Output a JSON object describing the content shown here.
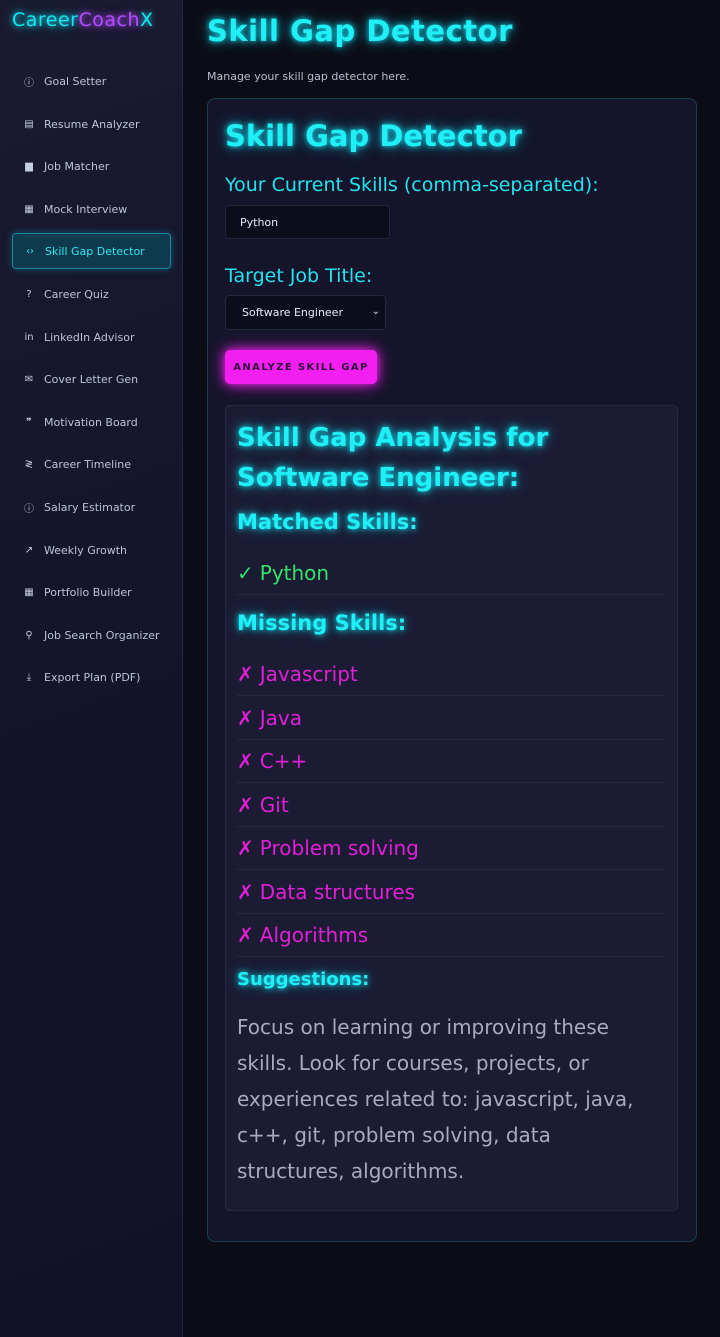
{
  "sidebar": {
    "logo": {
      "part1": "Career",
      "part2": "Coach",
      "part3": "X"
    },
    "items": [
      {
        "label": "Goal Setter",
        "icon": "info-circle-icon",
        "glyph": "ⓘ"
      },
      {
        "label": "Resume Analyzer",
        "icon": "document-icon",
        "glyph": "▤"
      },
      {
        "label": "Job Matcher",
        "icon": "briefcase-icon",
        "glyph": "▆"
      },
      {
        "label": "Mock Interview",
        "icon": "calendar-icon",
        "glyph": "▦"
      },
      {
        "label": "Skill Gap Detector",
        "icon": "code-icon",
        "glyph": "‹›",
        "active": true
      },
      {
        "label": "Career Quiz",
        "icon": "question-circle-icon",
        "glyph": "?"
      },
      {
        "label": "LinkedIn Advisor",
        "icon": "linkedin-icon",
        "glyph": "in"
      },
      {
        "label": "Cover Letter Gen",
        "icon": "envelope-icon",
        "glyph": "✉"
      },
      {
        "label": "Motivation Board",
        "icon": "quote-icon",
        "glyph": "❞"
      },
      {
        "label": "Career Timeline",
        "icon": "timeline-icon",
        "glyph": "≷"
      },
      {
        "label": "Salary Estimator",
        "icon": "info-circle-icon",
        "glyph": "ⓘ"
      },
      {
        "label": "Weekly Growth",
        "icon": "trending-up-icon",
        "glyph": "↗"
      },
      {
        "label": "Portfolio Builder",
        "icon": "calculator-icon",
        "glyph": "▦"
      },
      {
        "label": "Job Search Organizer",
        "icon": "search-icon",
        "glyph": "⚲"
      },
      {
        "label": "Export Plan (PDF)",
        "icon": "download-icon",
        "glyph": "⤓"
      }
    ]
  },
  "main": {
    "title": "Skill Gap Detector",
    "subtitle": "Manage your skill gap detector here."
  },
  "form": {
    "heading": "Skill Gap Detector",
    "skills_label": "Your Current Skills (comma-separated):",
    "skills_value": "Python",
    "job_label": "Target Job Title:",
    "job_value": "Software Engineer",
    "analyze_button": "ANALYZE SKILL GAP"
  },
  "results": {
    "title": "Skill Gap Analysis for Software Engineer:",
    "matched_heading": "Matched Skills:",
    "matched": [
      "Python"
    ],
    "matched_mark": "✓",
    "missing_heading": "Missing Skills:",
    "missing": [
      "Javascript",
      "Java",
      "C++",
      "Git",
      "Problem solving",
      "Data structures",
      "Algorithms"
    ],
    "missing_mark": "✗",
    "suggestions_heading": "Suggestions:",
    "suggestions_text": "Focus on learning or improving these skills. Look for courses, projects, or experiences related to: javascript, java, c++, git, problem solving, data structures, algorithms."
  },
  "colors": {
    "accent_cyan": "#1ff0f5",
    "accent_magenta": "#f21ff0",
    "matched_green": "#33e36a",
    "missing_magenta": "#e21fd8"
  }
}
